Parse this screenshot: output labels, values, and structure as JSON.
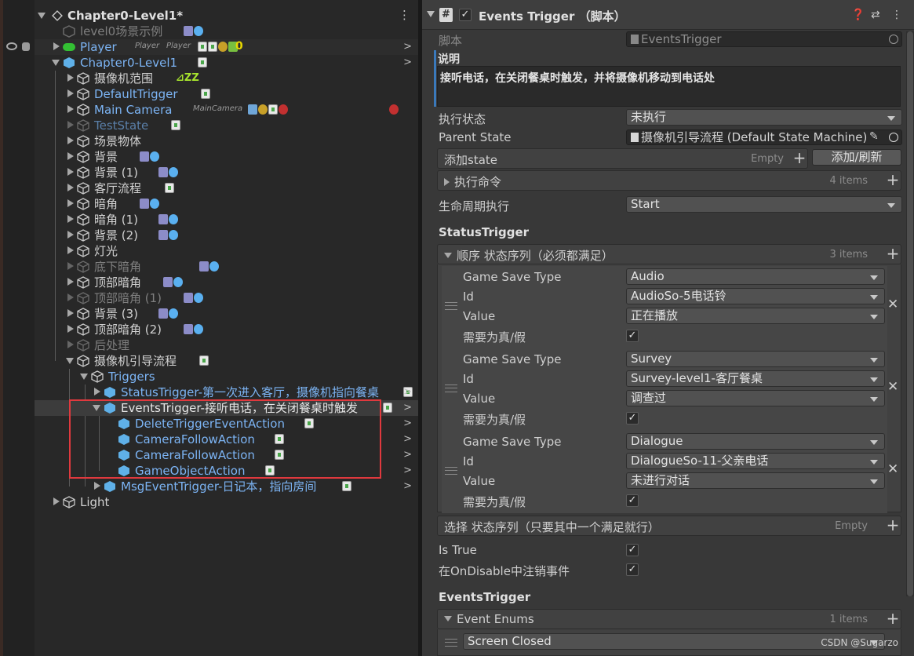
{
  "hierarchy": {
    "scene": "Chapter0-Level1*",
    "rows": [
      {
        "label": "level0场景示例"
      },
      {
        "label": "Player",
        "tag": "Player",
        "layer": "Player",
        "count": "0"
      },
      {
        "label": "Chapter0-Level1"
      },
      {
        "label": "摄像机范围"
      },
      {
        "label": "DefaultTrigger"
      },
      {
        "label": "Main Camera",
        "tag": "MainCamera"
      },
      {
        "label": "TestState"
      },
      {
        "label": "场景物体"
      },
      {
        "label": "背景"
      },
      {
        "label": "背景 (1)"
      },
      {
        "label": "客厅流程"
      },
      {
        "label": "暗角"
      },
      {
        "label": "暗角 (1)"
      },
      {
        "label": "背景 (2)"
      },
      {
        "label": "灯光"
      },
      {
        "label": "底下暗角"
      },
      {
        "label": "顶部暗角"
      },
      {
        "label": "顶部暗角 (1)"
      },
      {
        "label": "背景 (3)"
      },
      {
        "label": "顶部暗角 (2)"
      },
      {
        "label": "后处理"
      },
      {
        "label": "摄像机引导流程"
      },
      {
        "label": "Triggers"
      },
      {
        "label": "StatusTrigger-第一次进入客厅，摄像机指向餐桌"
      },
      {
        "label": "EventsTrigger-接听电话，在关闭餐桌时触发"
      },
      {
        "label": "DeleteTriggerEventAction"
      },
      {
        "label": "CameraFollowAction"
      },
      {
        "label": "CameraFollowAction"
      },
      {
        "label": "GameObjectAction"
      },
      {
        "label": "MsgEventTrigger-日记本，指向房间"
      },
      {
        "label": "Light"
      }
    ]
  },
  "inspector": {
    "title": "Events Trigger （脚本）",
    "script_label": "脚本",
    "script_value": "EventsTrigger",
    "desc_label": "说明",
    "desc_text": "接听电话，在关闭餐桌时触发，并将摄像机移动到电话处",
    "exec_state_label": "执行状态",
    "exec_state_value": "未执行",
    "parent_state_label": "Parent State",
    "parent_state_value": "摄像机引导流程 (Default State Machine)",
    "add_state_label": "添加state",
    "add_state_empty": "Empty",
    "add_refresh_btn": "添加/刷新",
    "exec_cmd_label": "执行命令",
    "exec_cmd_count": "4 items",
    "lifecycle_label": "生命周期执行",
    "lifecycle_value": "Start",
    "status_trigger_heading": "StatusTrigger",
    "seq_list_label": "顺序 状态序列（必须都满足）",
    "seq_list_count": "3 items",
    "field_labels": {
      "type": "Game Save Type",
      "id": "Id",
      "value": "Value",
      "must_true": "需要为真/假"
    },
    "elements": [
      {
        "type": "Audio",
        "id": "AudioSo-5电话铃",
        "value": "正在播放"
      },
      {
        "type": "Survey",
        "id": "Survey-level1-客厅餐桌",
        "value": "调查过"
      },
      {
        "type": "Dialogue",
        "id": "DialogueSo-11-父亲电话",
        "value": "未进行对话"
      }
    ],
    "select_list_label": "选择 状态序列（只要其中一个满足就行）",
    "select_list_empty": "Empty",
    "is_true_label": "Is True",
    "ondisable_label": "在OnDisable中注销事件",
    "events_trigger_heading": "EventsTrigger",
    "event_enums_label": "Event Enums",
    "event_enums_count": "1 items",
    "event_enum_0": "Screen Closed",
    "check_glyph": "✓",
    "watermark": "CSDN @Sugarzo"
  }
}
